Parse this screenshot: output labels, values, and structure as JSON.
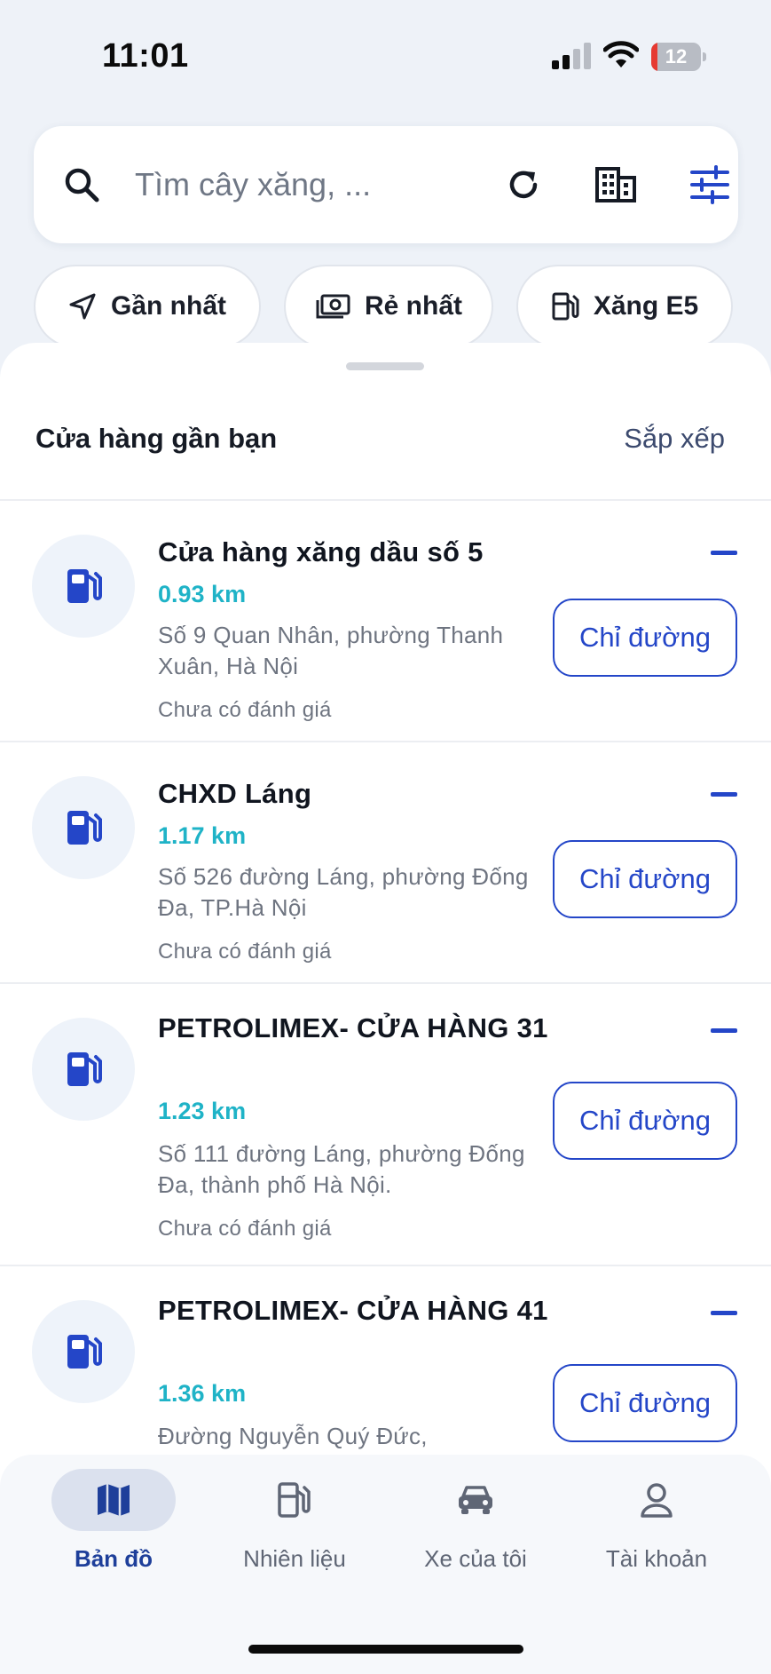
{
  "status_bar": {
    "time": "11:01",
    "battery_level": "12",
    "battery_fraction": 0.12
  },
  "search": {
    "placeholder": "Tìm cây xăng, ..."
  },
  "chips": [
    {
      "label": "Gần nhất",
      "icon": "navigation-arrow-icon"
    },
    {
      "label": "Rẻ nhất",
      "icon": "cash-icon"
    },
    {
      "label": "Xăng E5",
      "icon": "fuel-pump-icon"
    }
  ],
  "sheet": {
    "title": "Cửa hàng gần bạn",
    "sort_label": "Sắp xếp",
    "route_label": "Chỉ đường"
  },
  "stations": [
    {
      "name": "Cửa hàng xăng dầu số 5",
      "distance": "0.93 km",
      "address": "Số 9 Quan Nhân, phường Thanh Xuân, Hà Nội",
      "rating": "Chưa có đánh giá"
    },
    {
      "name": "CHXD Láng",
      "distance": "1.17 km",
      "address": "Số 526 đường Láng, phường Đống Đa, TP.Hà Nội",
      "rating": "Chưa có đánh giá"
    },
    {
      "name": "PETROLIMEX- CỬA HÀNG 31",
      "distance": "1.23 km",
      "address": "Số 111 đường Láng, phường Đống Đa, thành phố Hà Nội.",
      "rating": "Chưa có đánh giá"
    },
    {
      "name": "PETROLIMEX- CỬA HÀNG 41",
      "distance": "1.36 km",
      "address": "Đường Nguyễn Quý Đức,",
      "rating": ""
    }
  ],
  "nav": [
    {
      "label": "Bản đồ",
      "icon": "map-icon",
      "active": true
    },
    {
      "label": "Nhiên liệu",
      "icon": "fuel-pump-icon",
      "active": false
    },
    {
      "label": "Xe của tôi",
      "icon": "car-icon",
      "active": false
    },
    {
      "label": "Tài khoản",
      "icon": "user-icon",
      "active": false
    }
  ],
  "colors": {
    "accent": "#2446c8",
    "distance": "#1fb3c7",
    "battery_low": "#e63a32"
  }
}
